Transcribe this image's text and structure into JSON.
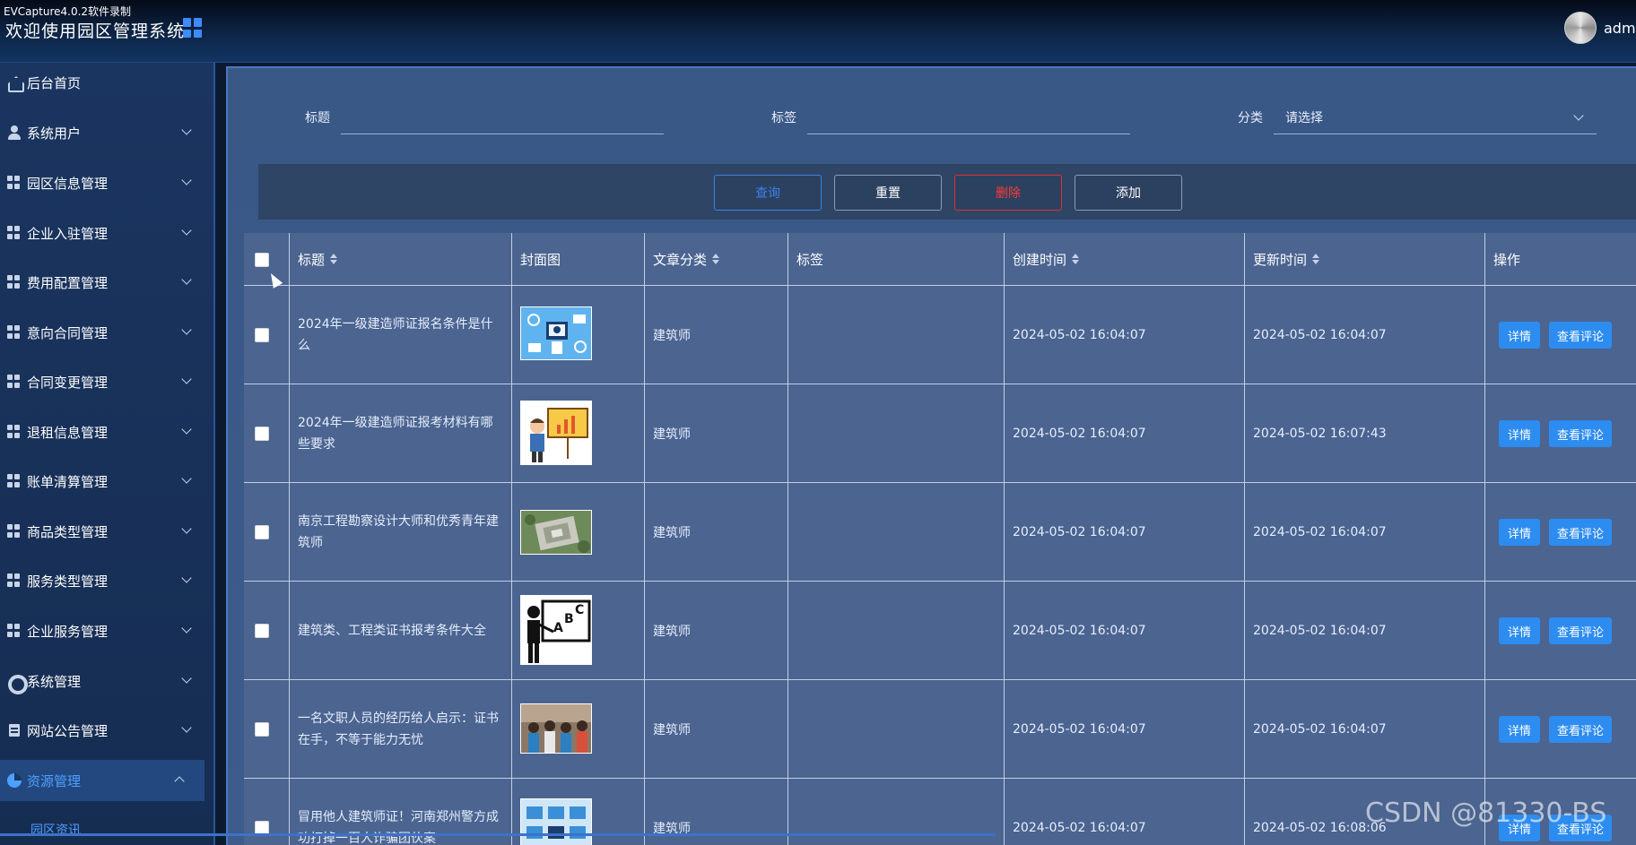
{
  "capture_label": "EVCapture4.0.2软件录制",
  "header": {
    "title": "欢迎使用园区管理系统",
    "username": "admin"
  },
  "sidebar": {
    "items": [
      {
        "label": "后台首页",
        "icon": "home-icon"
      },
      {
        "label": "系统用户",
        "icon": "user-icon"
      },
      {
        "label": "园区信息管理",
        "icon": "grid-icon"
      },
      {
        "label": "企业入驻管理",
        "icon": "grid-icon"
      },
      {
        "label": "费用配置管理",
        "icon": "grid-icon"
      },
      {
        "label": "意向合同管理",
        "icon": "grid-icon"
      },
      {
        "label": "合同变更管理",
        "icon": "grid-icon"
      },
      {
        "label": "退租信息管理",
        "icon": "grid-icon"
      },
      {
        "label": "账单清算管理",
        "icon": "grid-icon"
      },
      {
        "label": "商品类型管理",
        "icon": "grid-icon"
      },
      {
        "label": "服务类型管理",
        "icon": "grid-icon"
      },
      {
        "label": "企业服务管理",
        "icon": "grid-icon"
      },
      {
        "label": "系统管理",
        "icon": "gear-icon"
      },
      {
        "label": "网站公告管理",
        "icon": "document-icon"
      },
      {
        "label": "资源管理",
        "icon": "pie-chart-icon"
      }
    ],
    "submenu": {
      "label": "园区资讯"
    }
  },
  "search": {
    "title_label": "标题",
    "tag_label": "标签",
    "category_label": "分类",
    "category_placeholder": "请选择"
  },
  "toolbar": {
    "query": "查询",
    "reset": "重置",
    "delete": "删除",
    "add": "添加"
  },
  "table": {
    "headers": {
      "title": "标题",
      "cover": "封面图",
      "category": "文章分类",
      "tag": "标签",
      "created": "创建时间",
      "updated": "更新时间",
      "action": "操作"
    },
    "rows": [
      {
        "title": "2024年一级建造师证报名条件是什么",
        "category": "建筑师",
        "tag": "",
        "created": "2024-05-02 16:04:07",
        "updated": "2024-05-02 16:04:07"
      },
      {
        "title": "2024年一级建造师证报考材料有哪些要求",
        "category": "建筑师",
        "tag": "",
        "created": "2024-05-02 16:04:07",
        "updated": "2024-05-02 16:07:43"
      },
      {
        "title": "南京工程勘察设计大师和优秀青年建筑师",
        "category": "建筑师",
        "tag": "",
        "created": "2024-05-02 16:04:07",
        "updated": "2024-05-02 16:04:07"
      },
      {
        "title": "建筑类、工程类证书报考条件大全",
        "category": "建筑师",
        "tag": "",
        "created": "2024-05-02 16:04:07",
        "updated": "2024-05-02 16:04:07"
      },
      {
        "title": "一名文职人员的经历给人启示：证书在手，不等于能力无忧",
        "category": "建筑师",
        "tag": "",
        "created": "2024-05-02 16:04:07",
        "updated": "2024-05-02 16:04:07"
      },
      {
        "title": "冒用他人建筑师证！河南郑州警方成功打掉一百人诈骗团伙案",
        "category": "建筑师",
        "tag": "",
        "created": "2024-05-02 16:04:07",
        "updated": "2024-05-02 16:08:06"
      }
    ],
    "detail_label": "详情",
    "comments_label": "查看评论"
  },
  "watermark": "CSDN @81330-BS",
  "colors": {
    "accent": "#2d8cf0",
    "danger": "#e03030",
    "active_menu": "#4da0ff"
  }
}
